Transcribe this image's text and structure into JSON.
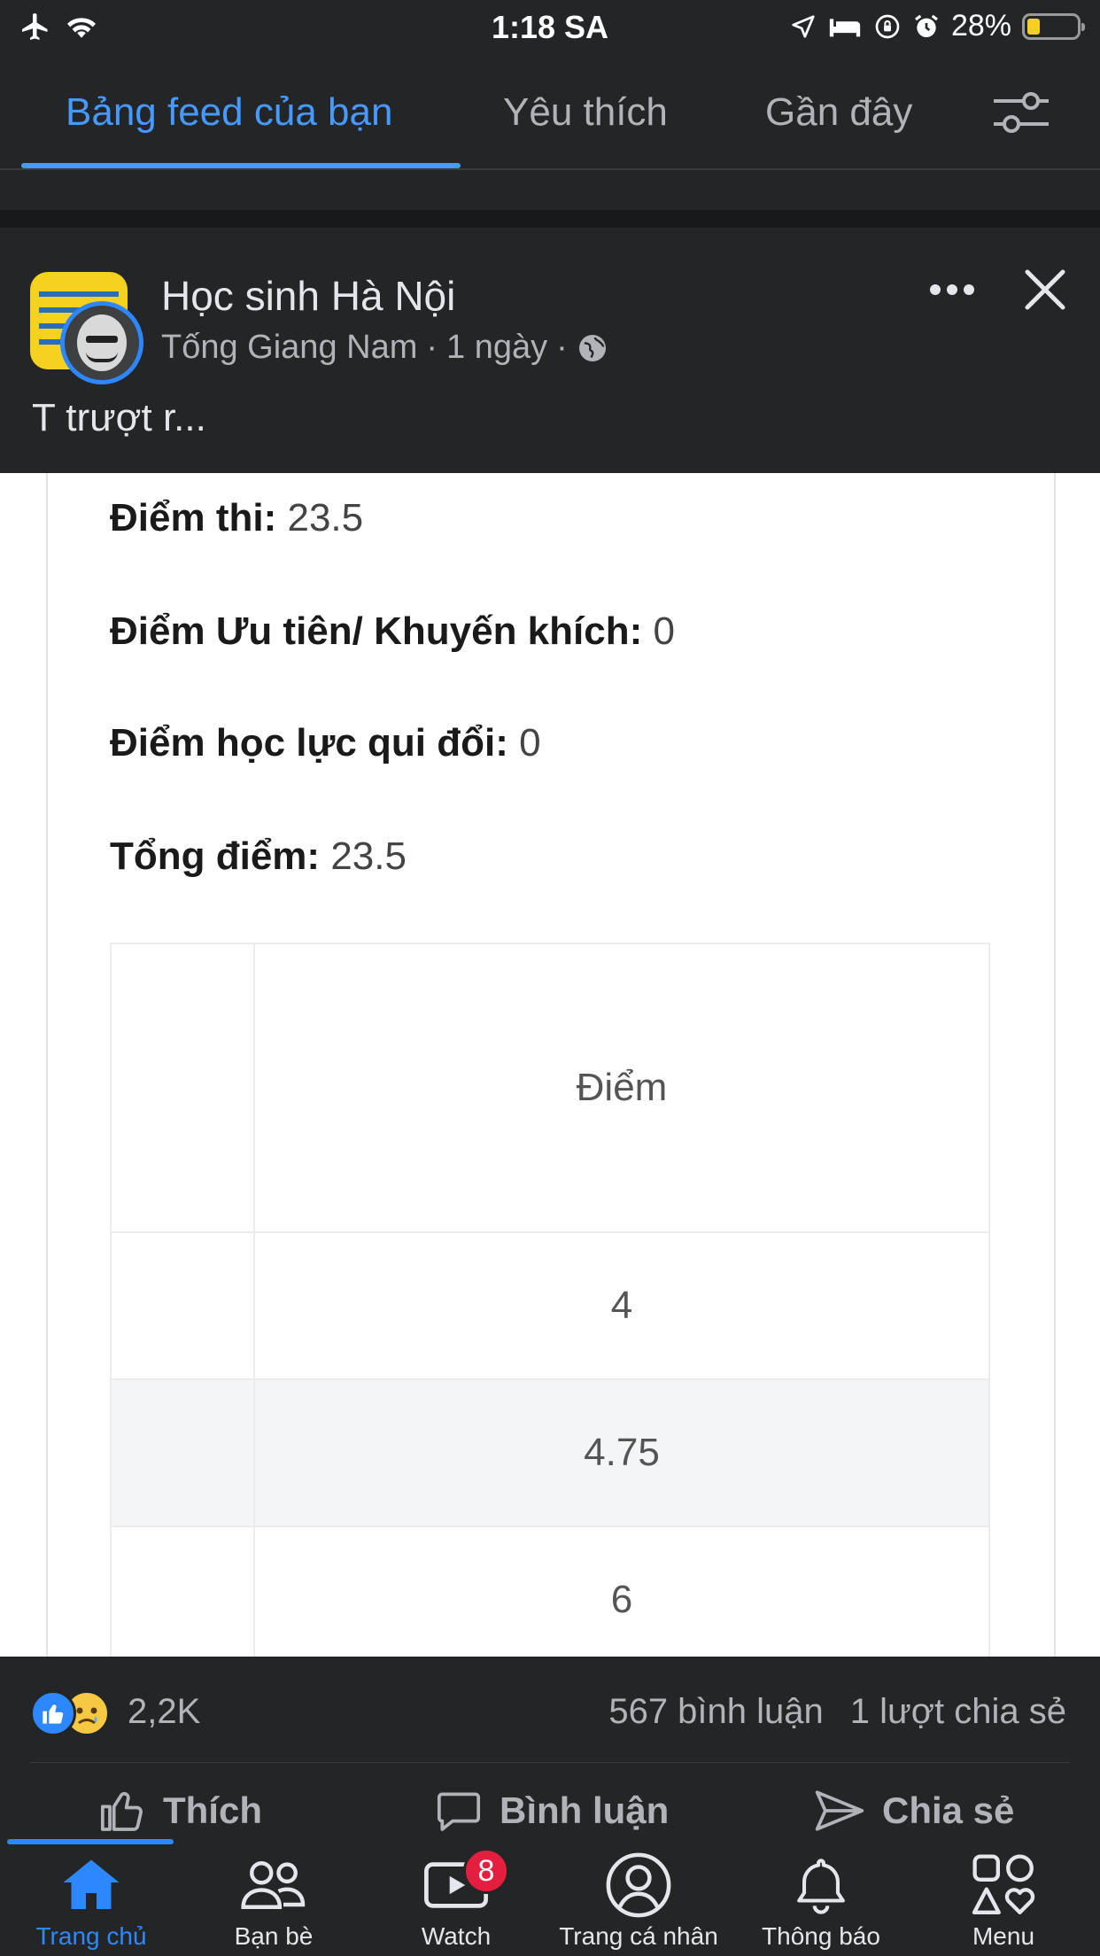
{
  "status_bar": {
    "time": "1:18 SA",
    "battery": "28%"
  },
  "tabs": [
    {
      "label": "Bảng feed của bạn"
    },
    {
      "label": "Yêu thích"
    },
    {
      "label": "Gần đây"
    }
  ],
  "post": {
    "group_name": "Học sinh Hà Nội",
    "author": "Tống Giang Nam",
    "time": "1 ngày",
    "text": "T trượt r...",
    "image": {
      "score_lines": [
        {
          "label": "Điểm thi:",
          "value": "23.5"
        },
        {
          "label": "Điểm Ưu tiên/ Khuyến khích:",
          "value": "0"
        },
        {
          "label": "Điểm học lực qui đổi:",
          "value": "0"
        },
        {
          "label": "Tổng điểm:",
          "value": "23.5"
        }
      ],
      "table": {
        "header": "Điểm",
        "rows": [
          "4",
          "4.75",
          "6"
        ]
      }
    },
    "reactions": {
      "count": "2,2K",
      "comments": "567 bình luận",
      "shares": "1 lượt chia sẻ"
    },
    "actions": {
      "like": "Thích",
      "comment": "Bình luận",
      "share": "Chia sẻ"
    }
  },
  "bottom_nav": [
    {
      "label": "Trang chủ"
    },
    {
      "label": "Bạn bè"
    },
    {
      "label": "Watch",
      "badge": "8"
    },
    {
      "label": "Trang cá nhân"
    },
    {
      "label": "Thông báo"
    },
    {
      "label": "Menu"
    }
  ],
  "colors": {
    "accent": "#2d88ff",
    "tab_active": "#4599ff",
    "background": "#242526",
    "badge": "#e41e3f"
  }
}
